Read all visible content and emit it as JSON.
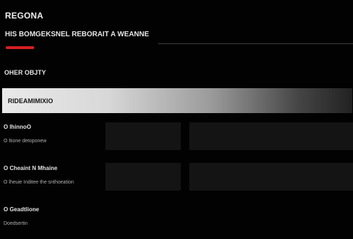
{
  "app": {
    "title": "REGONA"
  },
  "header": {
    "subtitle": "HIS BOMGEKSNEL   REBORAIT A WEANNE"
  },
  "section": {
    "label": "OHER OBJTY"
  },
  "selected_option": {
    "label": "RIDEAMIMIXIO"
  },
  "options": [
    {
      "name": "O lhinnoO",
      "description": "O ltione detoponew"
    },
    {
      "name": "O Cheaint N Mhaine",
      "description": "O lheuie Inditee the snthoeation"
    },
    {
      "name": "O Geadtlione",
      "description": "Doedsertin"
    }
  ],
  "colors": {
    "background": "#020202",
    "accent": "#d51f1f",
    "selected_row_light": "#e9e9e9",
    "placeholder_panel": "#141414"
  }
}
